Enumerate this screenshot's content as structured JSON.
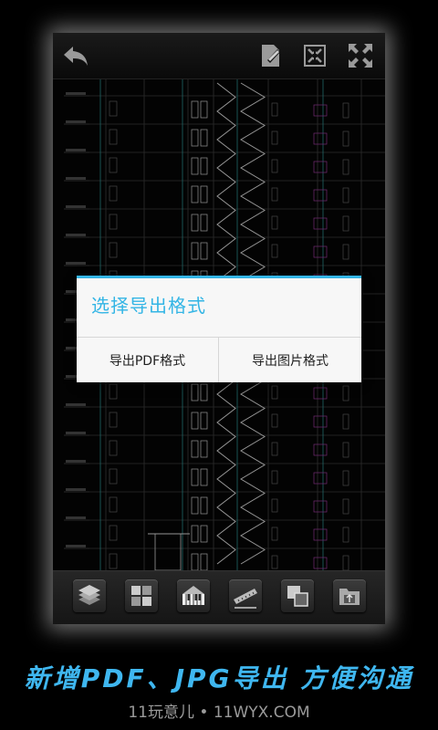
{
  "toolbar": {
    "back_icon": "back-arrow-icon",
    "export_icon": "export-document-icon",
    "fit_icon": "fit-screen-icon",
    "fullscreen_icon": "fullscreen-icon"
  },
  "dialog": {
    "title": "选择导出格式",
    "pdf_button": "导出PDF格式",
    "image_button": "导出图片格式",
    "accent_color": "#33b5e5"
  },
  "bottom_tools": [
    {
      "icon": "layers-icon"
    },
    {
      "icon": "layout-icon"
    },
    {
      "icon": "piano-keys-icon"
    },
    {
      "icon": "measure-ruler-icon"
    },
    {
      "icon": "copy-paste-icon"
    },
    {
      "icon": "folder-icon"
    }
  ],
  "promo": {
    "text": "新增PDF、JPG导出  方便沟通",
    "watermark": "11玩意儿 • 11WYX.COM",
    "color": "#3fb7f0"
  }
}
